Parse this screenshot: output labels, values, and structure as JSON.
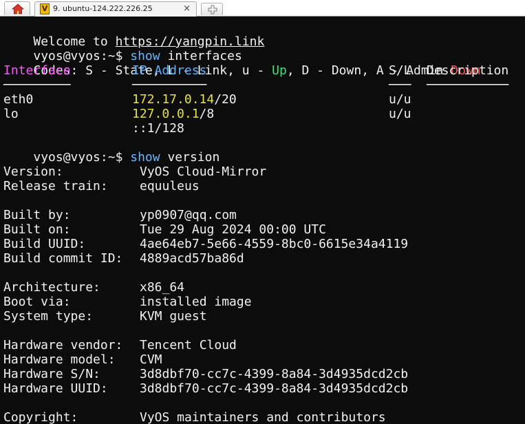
{
  "tabbar": {
    "tab_icon_letter": "V",
    "tab_title": "9. ubuntu-124.222.226.25",
    "close_glyph": "×",
    "icons": [
      "home-icon",
      "new-tab-icon"
    ]
  },
  "colors": {
    "background": "#0c0c0c",
    "text": "#f2f2f2",
    "command": "#6cb6ff",
    "header_interface": "#ff55ff",
    "header_columns": "#5fb4ff",
    "up": "#3fe07a",
    "down": "#ff5555",
    "ip": "#e6e245"
  },
  "terminal": {
    "welcome_prefix": "Welcome to ",
    "welcome_link": "https://yangpin.link",
    "prompt": "vyos@vyos:~$ ",
    "cmd_show": "show",
    "cmd1_arg": " interfaces",
    "cmd2_arg": " version",
    "codes": {
      "prefix": "Codes: S - State, L - Link, u - ",
      "up": "Up",
      "middle": ", D - Down, A - Admin ",
      "down": "Down"
    },
    "table": {
      "headers": {
        "interface": "Interface",
        "ip": "IP Address",
        "sl": "S/L",
        "description": "Description"
      },
      "underlines": {
        "interface": "─────────",
        "ip": "──────────",
        "sl": "───",
        "description": "───────────"
      },
      "rows": [
        {
          "name": "eth0",
          "ip": "172.17.0.14",
          "mask": "/20",
          "sl": "u/u"
        },
        {
          "name": "lo",
          "ip": "127.0.0.1",
          "mask": "/8",
          "sl": "u/u"
        }
      ],
      "extra_ip": "::1/128"
    },
    "version": [
      {
        "label": "Version:",
        "value": "VyOS Cloud-Mirror"
      },
      {
        "label": "Release train:",
        "value": "equuleus"
      },
      {
        "label": "Built by:",
        "value": "yp0907@qq.com"
      },
      {
        "label": "Built on:",
        "value": "Tue 29 Aug 2024 00:00 UTC"
      },
      {
        "label": "Build UUID:",
        "value": "4ae64eb7-5e66-4559-8bc0-6615e34a4119"
      },
      {
        "label": "Build commit ID:",
        "value": "4889acd57ba86d"
      },
      {
        "label": "Architecture:",
        "value": "x86_64"
      },
      {
        "label": "Boot via:",
        "value": "installed image"
      },
      {
        "label": "System type:",
        "value": "KVM guest"
      },
      {
        "label": "Hardware vendor:",
        "value": "Tencent Cloud"
      },
      {
        "label": "Hardware model:",
        "value": "CVM"
      },
      {
        "label": "Hardware S/N:",
        "value": "3d8dbf70-cc7c-4399-8a84-3d4935dcd2cb"
      },
      {
        "label": "Hardware UUID:",
        "value": "3d8dbf70-cc7c-4399-8a84-3d4935dcd2cb"
      },
      {
        "label": "Copyright:",
        "value": "VyOS maintainers and contributors"
      }
    ]
  }
}
